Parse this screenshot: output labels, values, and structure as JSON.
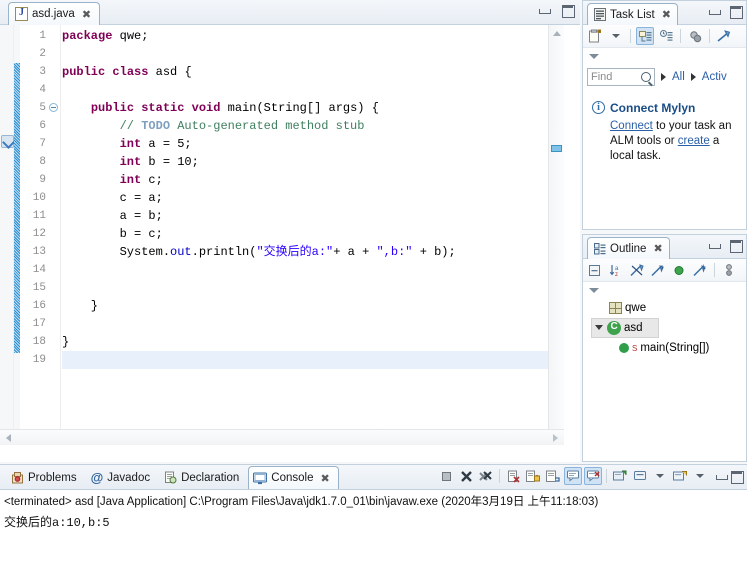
{
  "editor": {
    "tab": {
      "label": "asd.java",
      "icon": "java-file-icon",
      "close": "✖"
    },
    "window_buttons": {
      "minimize": "minimize",
      "maximize": "maximize"
    },
    "line_numbers": [
      "1",
      "2",
      "3",
      "4",
      "5",
      "6",
      "7",
      "8",
      "9",
      "10",
      "11",
      "12",
      "13",
      "14",
      "15",
      "16",
      "17",
      "18",
      "19"
    ],
    "current_line": 19,
    "code": [
      {
        "n": 1,
        "tokens": [
          {
            "t": "package",
            "c": "kw"
          },
          {
            "t": " qwe;",
            "c": "plain"
          }
        ]
      },
      {
        "n": 2,
        "tokens": []
      },
      {
        "n": 3,
        "tokens": [
          {
            "t": "public",
            "c": "kw"
          },
          {
            "t": " ",
            "c": "plain"
          },
          {
            "t": "class",
            "c": "kw"
          },
          {
            "t": " asd {",
            "c": "plain"
          }
        ]
      },
      {
        "n": 4,
        "tokens": []
      },
      {
        "n": 5,
        "tokens": [
          {
            "t": "    ",
            "c": "plain"
          },
          {
            "t": "public",
            "c": "kw"
          },
          {
            "t": " ",
            "c": "plain"
          },
          {
            "t": "static",
            "c": "kw"
          },
          {
            "t": " ",
            "c": "plain"
          },
          {
            "t": "void",
            "c": "kw"
          },
          {
            "t": " main(String[] args) {",
            "c": "plain"
          }
        ]
      },
      {
        "n": 6,
        "tokens": [
          {
            "t": "        ",
            "c": "plain"
          },
          {
            "t": "// ",
            "c": "cmt"
          },
          {
            "t": "TODO",
            "c": "todo"
          },
          {
            "t": " Auto-generated method stub",
            "c": "cmt"
          }
        ]
      },
      {
        "n": 7,
        "tokens": [
          {
            "t": "        ",
            "c": "plain"
          },
          {
            "t": "int",
            "c": "kw"
          },
          {
            "t": " a = 5;",
            "c": "plain"
          }
        ]
      },
      {
        "n": 8,
        "tokens": [
          {
            "t": "        ",
            "c": "plain"
          },
          {
            "t": "int",
            "c": "kw"
          },
          {
            "t": " b = 10;",
            "c": "plain"
          }
        ]
      },
      {
        "n": 9,
        "tokens": [
          {
            "t": "        ",
            "c": "plain"
          },
          {
            "t": "int",
            "c": "kw"
          },
          {
            "t": " c;",
            "c": "plain"
          }
        ]
      },
      {
        "n": 10,
        "tokens": [
          {
            "t": "        c = a;",
            "c": "plain"
          }
        ]
      },
      {
        "n": 11,
        "tokens": [
          {
            "t": "        a = b;",
            "c": "plain"
          }
        ]
      },
      {
        "n": 12,
        "tokens": [
          {
            "t": "        b = c;",
            "c": "plain"
          }
        ]
      },
      {
        "n": 13,
        "tokens": [
          {
            "t": "        System.",
            "c": "plain"
          },
          {
            "t": "out",
            "c": "fld"
          },
          {
            "t": ".println(",
            "c": "plain"
          },
          {
            "t": "\"交换后的a:\"",
            "c": "str"
          },
          {
            "t": "+ a + ",
            "c": "plain"
          },
          {
            "t": "\",b:\"",
            "c": "str"
          },
          {
            "t": " + b);",
            "c": "plain"
          }
        ]
      },
      {
        "n": 14,
        "tokens": []
      },
      {
        "n": 15,
        "tokens": []
      },
      {
        "n": 16,
        "tokens": [
          {
            "t": "    }",
            "c": "plain"
          }
        ]
      },
      {
        "n": 17,
        "tokens": []
      },
      {
        "n": 18,
        "tokens": [
          {
            "t": "}",
            "c": "plain"
          }
        ]
      },
      {
        "n": 19,
        "tokens": []
      }
    ],
    "fold_markers": [
      5
    ],
    "quickfix_marker_line": 6,
    "change_bar": {
      "from_line": 3,
      "to_line": 18
    }
  },
  "task_list": {
    "tab": {
      "label": "Task List",
      "icon": "task-list-icon",
      "close": "✖"
    },
    "toolbar": [
      {
        "name": "new-task-icon",
        "selected": false
      },
      {
        "name": "new-task-dropdown-icon",
        "selected": false
      },
      {
        "name": "categorized-presentation-icon",
        "selected": true
      },
      {
        "name": "scheduled-presentation-icon",
        "selected": false
      },
      {
        "name": "focus-on-workweek-icon",
        "selected": false
      },
      {
        "name": "collapse-all-icon",
        "selected": false
      }
    ],
    "view_menu_icon": "view-menu-chevron",
    "find": {
      "placeholder": "Find",
      "value": "",
      "icon": "search-icon"
    },
    "filters": [
      {
        "label": "All"
      },
      {
        "label": "Activ"
      }
    ],
    "mylyn": {
      "title": "Connect Mylyn",
      "icon": "info-icon",
      "line1_link": "Connect",
      "line1_rest": " to your task an",
      "line2_pre": "ALM tools or ",
      "line2_link": "create",
      "line2_post": " a",
      "line3": "local task."
    }
  },
  "outline": {
    "tab": {
      "label": "Outline",
      "icon": "outline-icon",
      "close": "✖"
    },
    "toolbar": [
      {
        "name": "collapse-all-icon",
        "selected": false
      },
      {
        "name": "sort-alphabetically-icon",
        "selected": false
      },
      {
        "name": "hide-fields-icon",
        "selected": false
      },
      {
        "name": "hide-static-icon",
        "selected": false
      },
      {
        "name": "hide-nonpublic-icon",
        "selected": false
      },
      {
        "name": "hide-local-types-icon",
        "selected": false
      }
    ],
    "view_menu_icon": "view-menu-chevron",
    "tree": [
      {
        "label": "qwe",
        "icon": "package-icon",
        "indent": 1,
        "twisty": "none",
        "selected": false
      },
      {
        "label": "asd",
        "icon": "class-icon",
        "indent": 0,
        "twisty": "open",
        "selected": true
      },
      {
        "label": "main(String[])",
        "icon": "method-icon",
        "indent": 2,
        "twisty": "none",
        "selected": false,
        "modifier": "S"
      }
    ]
  },
  "bottom_panel": {
    "tabs": [
      {
        "label": "Problems",
        "icon": "problems-icon",
        "active": false
      },
      {
        "label": "Javadoc",
        "icon": "javadoc-icon",
        "active": false
      },
      {
        "label": "Declaration",
        "icon": "declaration-icon",
        "active": false
      },
      {
        "label": "Console",
        "icon": "console-icon",
        "active": true,
        "close": "✖"
      }
    ],
    "toolbar": [
      {
        "name": "terminate-icon",
        "selected": false
      },
      {
        "name": "remove-launch-icon",
        "selected": false
      },
      {
        "name": "remove-all-terminated-icon",
        "selected": false
      },
      {
        "name": "clear-console-icon",
        "selected": false
      },
      {
        "name": "scroll-lock-icon",
        "selected": false
      },
      {
        "name": "word-wrap-icon",
        "selected": false
      },
      {
        "name": "show-console-on-output-icon",
        "selected": true
      },
      {
        "name": "show-console-on-error-icon",
        "selected": true
      },
      {
        "name": "pin-console-icon",
        "selected": false
      },
      {
        "name": "display-selected-console-icon",
        "selected": false
      },
      {
        "name": "display-selected-console-dropdown-icon",
        "selected": false
      },
      {
        "name": "open-console-icon",
        "selected": false
      },
      {
        "name": "open-console-dropdown-icon",
        "selected": false
      },
      {
        "name": "minimize-icon",
        "selected": false
      },
      {
        "name": "maximize-icon",
        "selected": false
      }
    ],
    "console": {
      "terminated_line": "<terminated> asd [Java Application] C:\\Program Files\\Java\\jdk1.7.0_01\\bin\\javaw.exe (2020年3月19日 上午11:18:03)",
      "output_lines": [
        "交换后的a:10,b:5"
      ]
    }
  },
  "colors": {
    "keyword": "#7f0055",
    "comment": "#3f7f5f",
    "todo": "#7f9fbf",
    "string": "#2a00ff",
    "field": "#0000c0",
    "tab_border": "#9bb3c9",
    "link": "#2b5fa8",
    "current_line": "#e8f0fb",
    "change_bar": "#44a0d8",
    "selected_toolbar": "#cfe3f5"
  }
}
